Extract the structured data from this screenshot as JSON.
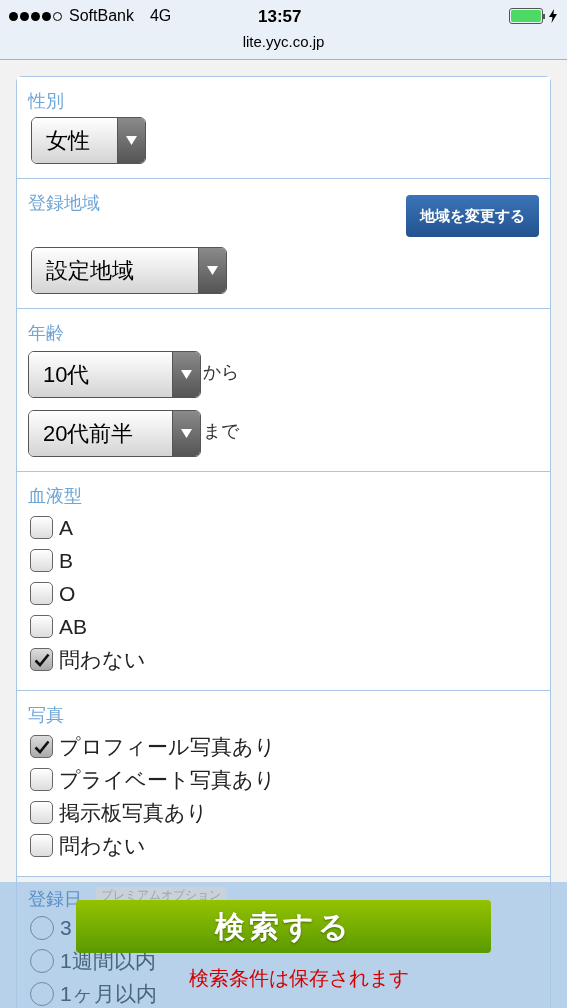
{
  "status_bar": {
    "carrier": "SoftBank",
    "network": "4G",
    "time": "13:57",
    "url": "lite.yyc.co.jp"
  },
  "sections": [
    {
      "label": "性別",
      "selects": [
        {
          "value": "女性"
        }
      ]
    },
    {
      "label": "登録地域",
      "button": "地域を変更する",
      "selects": [
        {
          "value": "設定地域"
        }
      ]
    },
    {
      "label": "年齢",
      "selects": [
        {
          "value": "10代",
          "suffix": "から"
        },
        {
          "value": "20代前半",
          "suffix": "まで"
        }
      ]
    },
    {
      "label": "血液型",
      "options": [
        {
          "kind": "checkbox",
          "label": "A",
          "checked": false
        },
        {
          "kind": "checkbox",
          "label": "B",
          "checked": false
        },
        {
          "kind": "checkbox",
          "label": "O",
          "checked": false
        },
        {
          "kind": "checkbox",
          "label": "AB",
          "checked": false
        },
        {
          "kind": "checkbox",
          "label": "問わない",
          "checked": true
        }
      ]
    },
    {
      "label": "写真",
      "options": [
        {
          "kind": "checkbox",
          "label": "プロフィール写真あり",
          "checked": true
        },
        {
          "kind": "checkbox",
          "label": "プライベート写真あり",
          "checked": false
        },
        {
          "kind": "checkbox",
          "label": "掲示板写真あり",
          "checked": false
        },
        {
          "kind": "checkbox",
          "label": "問わない",
          "checked": false
        }
      ]
    },
    {
      "label": "登録日",
      "badge": "プレミアムオプション",
      "options": [
        {
          "kind": "radio",
          "label": "3",
          "checked": false
        },
        {
          "kind": "radio",
          "label": "1週間以内",
          "checked": false
        },
        {
          "kind": "radio",
          "label": "1ヶ月以内",
          "checked": false
        }
      ]
    }
  ],
  "search_button": "検索する",
  "note": "検索条件は保存されます"
}
